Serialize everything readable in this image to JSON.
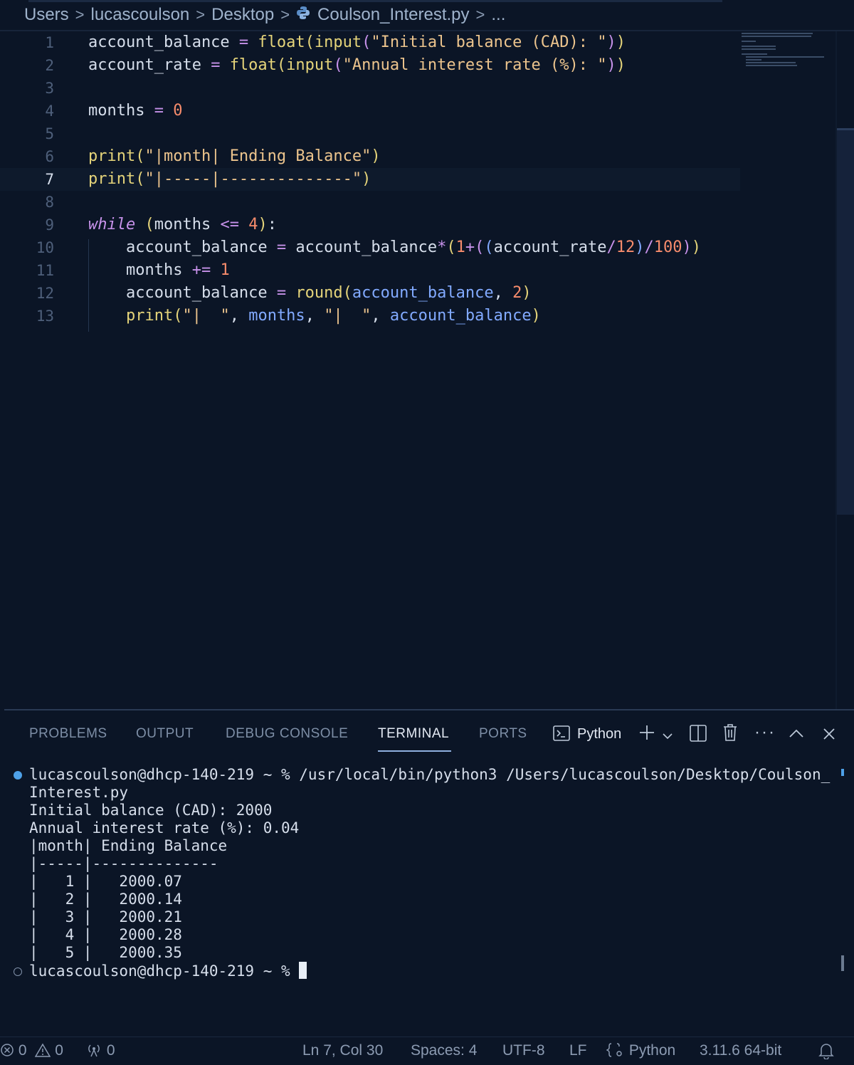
{
  "breadcrumb": {
    "parts": [
      "Users",
      "lucascoulson",
      "Desktop",
      "Coulson_Interest.py",
      "..."
    ]
  },
  "editor": {
    "line_numbers": [
      "1",
      "2",
      "3",
      "4",
      "5",
      "6",
      "7",
      "8",
      "9",
      "10",
      "11",
      "12",
      "13"
    ],
    "current_line": 7
  },
  "panel": {
    "tabs": [
      "PROBLEMS",
      "OUTPUT",
      "DEBUG CONSOLE",
      "TERMINAL",
      "PORTS"
    ],
    "active_tab": "TERMINAL",
    "terminal_profile": "Python",
    "terminal_lines": [
      "lucascoulson@dhcp-140-219 ~ % /usr/local/bin/python3 /Users/lucascoulson/Desktop/Coulson_",
      "Interest.py",
      "Initial balance (CAD): 2000",
      "Annual interest rate (%): 0.04",
      "|month| Ending Balance",
      "|-----|--------------",
      "|   1 |   2000.07",
      "|   2 |   2000.14",
      "|   3 |   2000.21",
      "|   4 |   2000.28",
      "|   5 |   2000.35"
    ],
    "prompt": "lucascoulson@dhcp-140-219 ~ % "
  },
  "status": {
    "errors": "0",
    "warnings": "0",
    "ports": "0",
    "position": "Ln 7, Col 30",
    "spaces": "Spaces: 4",
    "encoding": "UTF-8",
    "eol": "LF",
    "language": "Python",
    "interpreter": "3.11.6 64-bit"
  },
  "colors": {
    "background": "#0b1526",
    "accent": "#4ea1e8"
  }
}
